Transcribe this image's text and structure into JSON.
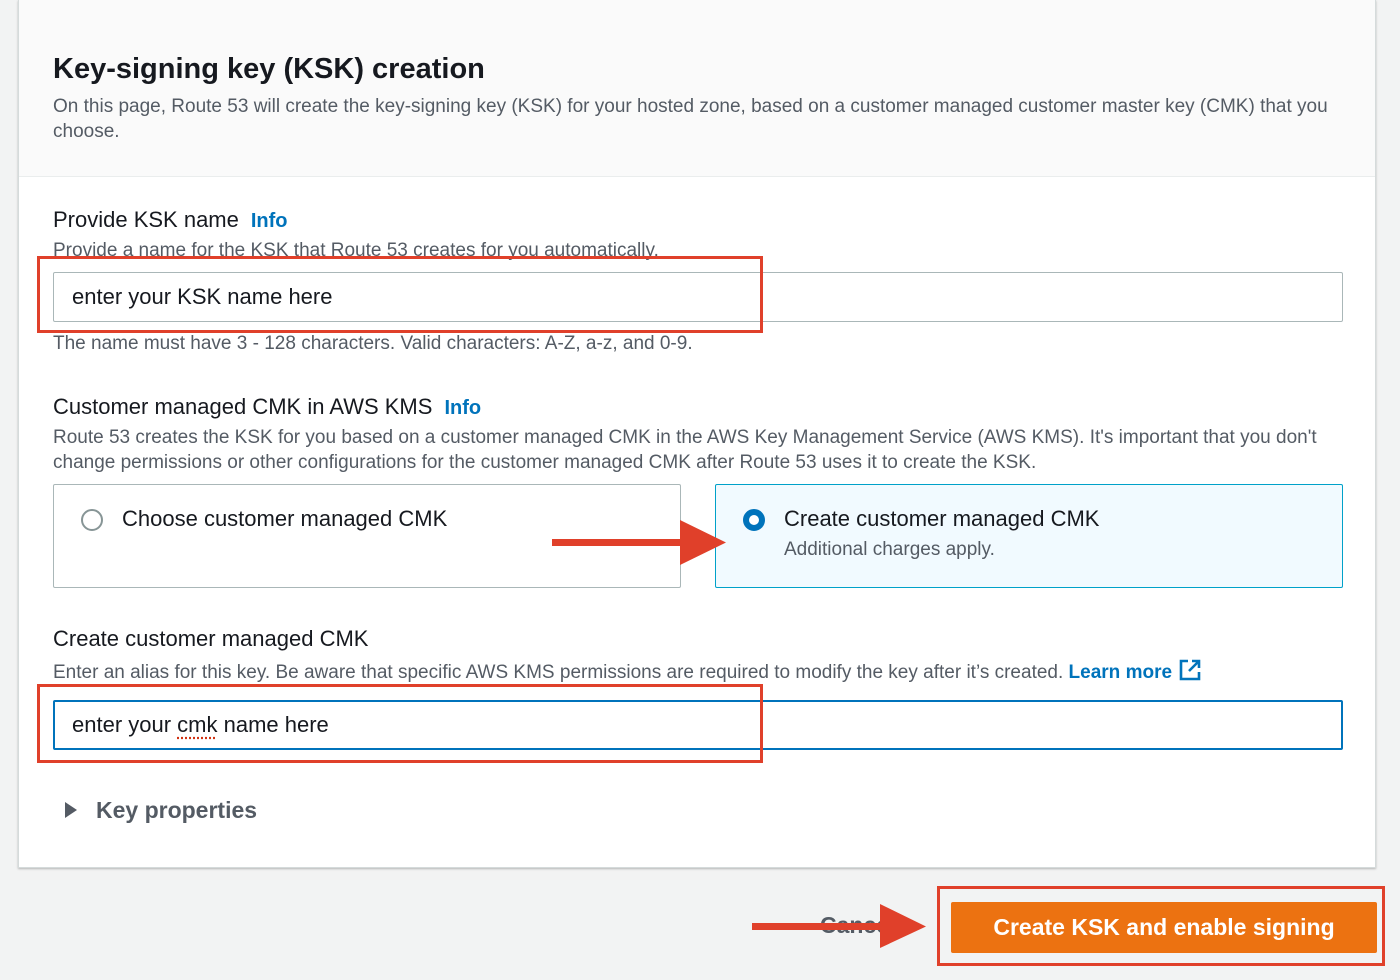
{
  "header": {
    "title": "Key-signing key (KSK) creation",
    "description": "On this page, Route 53 will create the key-signing key (KSK) for your hosted zone, based on a customer managed customer master key (CMK) that you choose."
  },
  "ksk_name": {
    "label": "Provide KSK name",
    "info": "Info",
    "description": "Provide a name for the KSK that Route 53 creates for you automatically.",
    "value": "enter your KSK name here",
    "constraint": "The name must have 3 - 128 characters. Valid characters: A-Z, a-z, and 0-9."
  },
  "cmk": {
    "label": "Customer managed CMK in AWS KMS",
    "info": "Info",
    "description": "Route 53 creates the KSK for you based on a customer managed CMK in the AWS Key Management Service (AWS KMS). It's important that you don't change permissions or other configurations for the customer managed CMK after Route 53 uses it to create the KSK.",
    "options": [
      {
        "label": "Choose customer managed CMK",
        "description": "",
        "selected": false
      },
      {
        "label": "Create customer managed CMK",
        "description": "Additional charges apply.",
        "selected": true
      }
    ]
  },
  "create_cmk": {
    "label": "Create customer managed CMK",
    "description": "Enter an alias for this key. Be aware that specific AWS KMS permissions are required to modify the key after it’s created.",
    "learn_more": "Learn more",
    "value_prefix": "enter your ",
    "value_word": "cmk",
    "value_suffix": " name here"
  },
  "key_properties": {
    "label": "Key properties"
  },
  "footer": {
    "cancel_label": "Cancel",
    "primary_label": "Create KSK and enable signing"
  },
  "colors": {
    "accent": "#0073bb",
    "primary_button": "#ec7211",
    "annotation": "#e0402a"
  }
}
